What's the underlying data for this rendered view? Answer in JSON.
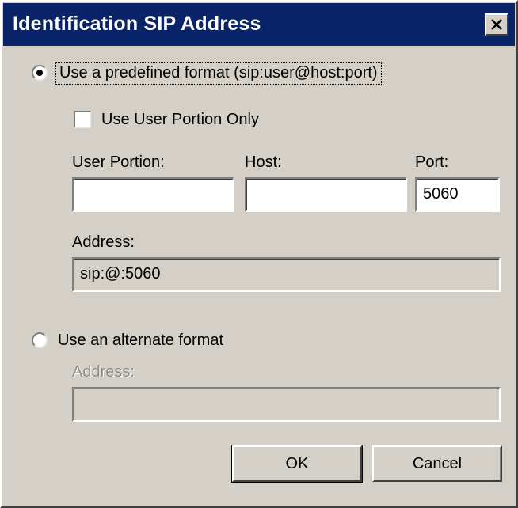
{
  "dialog": {
    "title": "Identification SIP Address",
    "close_icon": "close-icon"
  },
  "predefined": {
    "radio_label": "Use a predefined format (sip:user@host:port)",
    "selected": true,
    "use_user_portion_label": "Use User Portion Only",
    "use_user_portion_checked": false,
    "user_portion_label": "User Portion:",
    "user_portion_value": "",
    "host_label": "Host:",
    "host_value": "",
    "port_label": "Port:",
    "port_value": "5060",
    "address_label": "Address:",
    "address_value": "sip:@:5060"
  },
  "alternate": {
    "radio_label": "Use an alternate format",
    "selected": false,
    "address_label": "Address:",
    "address_value": ""
  },
  "buttons": {
    "ok_label": "OK",
    "cancel_label": "Cancel"
  }
}
